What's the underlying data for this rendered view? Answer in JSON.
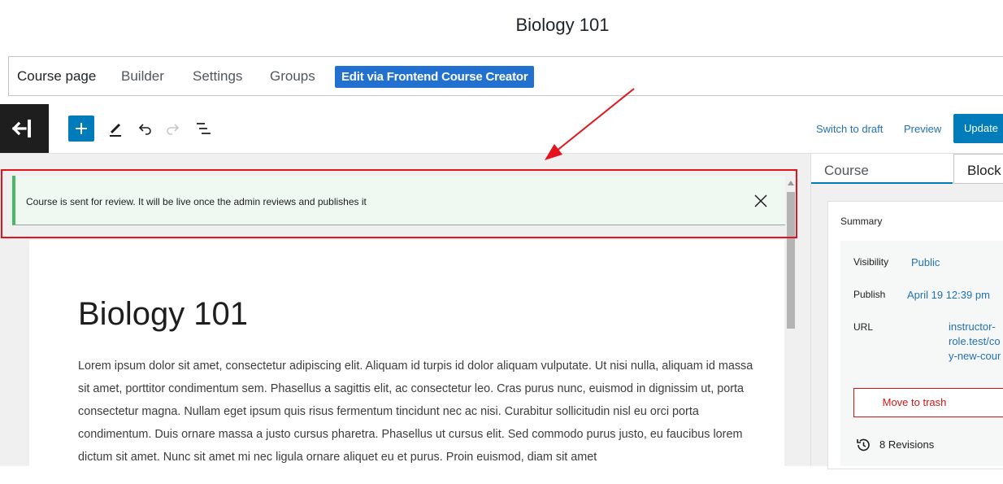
{
  "page": {
    "title": "Biology 101"
  },
  "tabs": {
    "items": [
      {
        "label": "Course page"
      },
      {
        "label": "Builder"
      },
      {
        "label": "Settings"
      },
      {
        "label": "Groups"
      }
    ],
    "frontend_button": "Edit via Frontend Course Creator"
  },
  "toolbar": {
    "switch_to_draft": "Switch to draft",
    "preview": "Preview",
    "update": "Update"
  },
  "notice": {
    "message": "Course is sent for review. It will be live once the admin reviews and publishes it",
    "status_color": "#4ab866",
    "highlight_color": "#e3141b"
  },
  "editor": {
    "title": "Biology 101",
    "paragraph": "Lorem ipsum dolor sit amet, consectetur adipiscing elit. Aliquam id turpis id dolor aliquam vulputate. Ut nisi nulla, aliquam id massa sit amet, porttitor condimentum sem. Phasellus a sagittis elit, ac consectetur leo. Cras purus nunc, euismod in dignissim ut, porta consectetur magna. Nullam eget ipsum quis risus fermentum tincidunt nec ac nisi. Curabitur sollicitudin nisl eu orci porta condimentum. Duis ornare massa a justo cursus pharetra. Phasellus ut cursus elit. Sed commodo purus justo, eu faucibus lorem dictum sit amet. Nunc sit amet mi nec ligula ornare aliquet eu et purus. Proin euismod, diam sit amet"
  },
  "sidebar": {
    "tabs": {
      "course": "Course",
      "block": "Block"
    },
    "summary": {
      "title": "Summary",
      "visibility_label": "Visibility",
      "visibility_value": "Public",
      "publish_label": "Publish",
      "publish_value": "April 19 12:39 pm",
      "url_label": "URL",
      "url_lines": [
        "instructor-",
        "role.test/co",
        "y-new-cour"
      ],
      "trash_button": "Move to trash",
      "revisions": "8 Revisions"
    }
  },
  "colors": {
    "accent": "#007cba",
    "link": "#2271b1",
    "danger": "#cc1818"
  },
  "icons": [
    "exit-icon",
    "plus-icon",
    "pencil-icon",
    "undo-icon",
    "redo-icon",
    "list-view-icon",
    "close-icon",
    "revisions-icon"
  ]
}
